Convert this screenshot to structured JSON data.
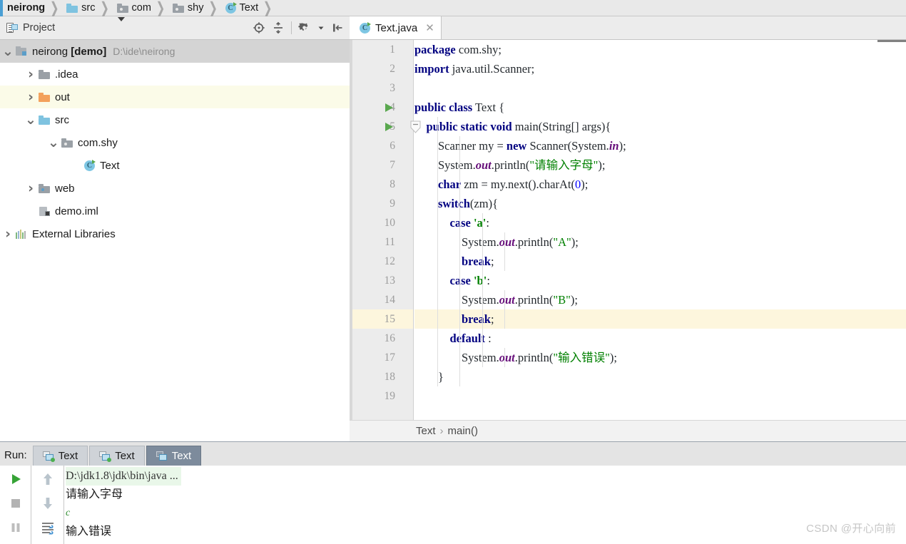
{
  "navbar": {
    "crumbs": [
      {
        "label": "neirong",
        "icon": "none"
      },
      {
        "label": "src",
        "icon": "folder-blue-icon"
      },
      {
        "label": "com",
        "icon": "folder-package-icon"
      },
      {
        "label": "shy",
        "icon": "folder-package-icon"
      },
      {
        "label": "Text",
        "icon": "java-class-icon"
      }
    ]
  },
  "project_panel": {
    "title": "Project",
    "icon": "project-view-icon",
    "dropdown_icon": "chevron-down-icon",
    "actions": [
      {
        "name": "locate-file-icon",
        "tooltip": "Select Opened File"
      },
      {
        "name": "collapse-all-icon",
        "tooltip": "Collapse All"
      },
      {
        "name": "gear-icon",
        "tooltip": "Settings"
      },
      {
        "name": "hide-panel-icon",
        "tooltip": "Hide"
      }
    ],
    "tree": [
      {
        "label": "neirong",
        "bold_suffix": "[demo]",
        "path": "D:\\ide\\neirong",
        "arrow": "expanded",
        "indent": 0,
        "icon": "project-root-icon",
        "state": "selected"
      },
      {
        "label": ".idea",
        "arrow": "collapsed",
        "indent": 1,
        "icon": "folder-gray-icon",
        "state": "normal"
      },
      {
        "label": "out",
        "arrow": "collapsed",
        "indent": 1,
        "icon": "folder-orange-icon",
        "state": "highlighted"
      },
      {
        "label": "src",
        "arrow": "expanded",
        "indent": 1,
        "icon": "folder-blue-icon",
        "state": "normal"
      },
      {
        "label": "com.shy",
        "arrow": "expanded",
        "indent": 2,
        "icon": "folder-package-icon",
        "state": "normal"
      },
      {
        "label": "Text",
        "arrow": "none",
        "indent": 3,
        "icon": "java-class-icon",
        "state": "normal"
      },
      {
        "label": "web",
        "arrow": "collapsed",
        "indent": 1,
        "icon": "folder-web-icon",
        "state": "normal"
      },
      {
        "label": "demo.iml",
        "arrow": "none",
        "indent": 1,
        "icon": "module-file-icon",
        "state": "normal"
      },
      {
        "label": "External Libraries",
        "arrow": "collapsed",
        "indent": 0,
        "icon": "external-libraries-icon",
        "state": "normal"
      }
    ]
  },
  "editor": {
    "tab": {
      "label": "Text.java",
      "icon": "java-class-icon",
      "close_icon": "close-icon"
    },
    "breadcrumb": {
      "class": "Text",
      "separator": "›",
      "method": "main()"
    },
    "highlighted_line": 15,
    "run_marker_lines": [
      4,
      5
    ],
    "fold_marker_line": 5,
    "lines": [
      {
        "n": 1,
        "text": "package com.shy;"
      },
      {
        "n": 2,
        "text": "import java.util.Scanner;"
      },
      {
        "n": 3,
        "text": ""
      },
      {
        "n": 4,
        "text": "public class Text {"
      },
      {
        "n": 5,
        "text": "    public static void main(String[] args){"
      },
      {
        "n": 6,
        "text": "        Scanner my = new Scanner(System.in);"
      },
      {
        "n": 7,
        "text": "        System.out.println(\"请输入字母\");"
      },
      {
        "n": 8,
        "text": "        char zm = my.next().charAt(0);"
      },
      {
        "n": 9,
        "text": "        switch(zm){"
      },
      {
        "n": 10,
        "text": "            case 'a':"
      },
      {
        "n": 11,
        "text": "                System.out.println(\"A\");"
      },
      {
        "n": 12,
        "text": "                break;"
      },
      {
        "n": 13,
        "text": "            case 'b':"
      },
      {
        "n": 14,
        "text": "                System.out.println(\"B\");"
      },
      {
        "n": 15,
        "text": "                break;"
      },
      {
        "n": 16,
        "text": "            default :"
      },
      {
        "n": 17,
        "text": "                System.out.println(\"输入错误\");"
      },
      {
        "n": 18,
        "text": "        }"
      },
      {
        "n": 19,
        "text": ""
      }
    ]
  },
  "run_panel": {
    "label": "Run:",
    "tabs": [
      {
        "label": "Text",
        "active": false
      },
      {
        "label": "Text",
        "active": false
      },
      {
        "label": "Text",
        "active": true
      }
    ],
    "side_actions": [
      {
        "name": "rerun-icon"
      },
      {
        "name": "stop-icon"
      },
      {
        "name": "pause-icon"
      }
    ],
    "side_actions2": [
      {
        "name": "up-arrow-icon"
      },
      {
        "name": "down-arrow-icon"
      },
      {
        "name": "soft-wrap-icon"
      }
    ],
    "console": [
      {
        "text": "D:\\jdk1.8\\jdk\\bin\\java ...",
        "style": "command"
      },
      {
        "text": "请输入字母",
        "style": "output"
      },
      {
        "text": "c",
        "style": "input"
      },
      {
        "text": "输入错误",
        "style": "output"
      }
    ]
  },
  "watermark": {
    "text": "CSDN @开心向前"
  },
  "colors": {
    "keyword": "#000080",
    "string": "#008000",
    "field": "#660e7a",
    "number": "#0000ff",
    "highlight_row": "#fdf6dd",
    "selection": "#d4d4d4",
    "accent": "#4a9fd4"
  }
}
